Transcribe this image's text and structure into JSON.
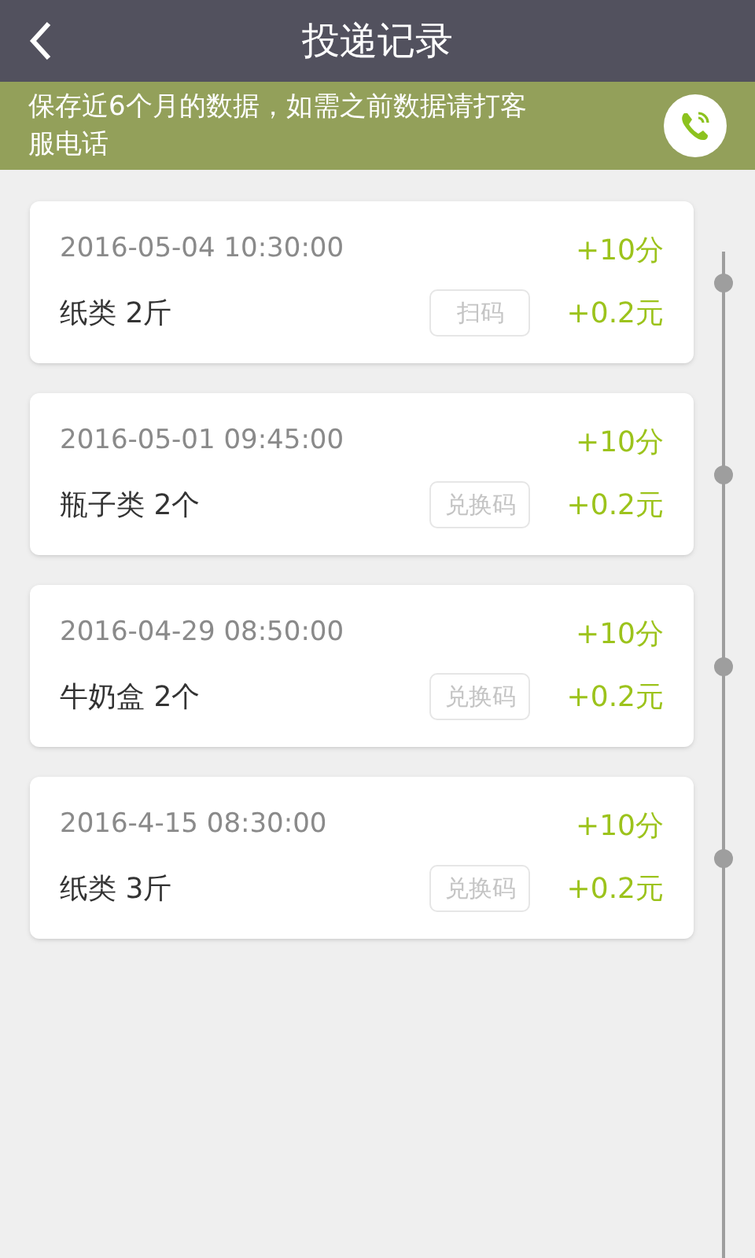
{
  "header": {
    "title": "投递记录"
  },
  "notice": {
    "text": "保存近6个月的数据，如需之前数据请打客服电话"
  },
  "records": [
    {
      "time": "2016-05-04 10:30:00",
      "item": "纸类 2斤",
      "code_button": "扫码",
      "points": "+10分",
      "money": "+0.2元"
    },
    {
      "time": "2016-05-01 09:45:00",
      "item": "瓶子类 2个",
      "code_button": "兑换码",
      "points": "+10分",
      "money": "+0.2元"
    },
    {
      "time": "2016-04-29 08:50:00",
      "item": "牛奶盒 2个",
      "code_button": "兑换码",
      "points": "+10分",
      "money": "+0.2元"
    },
    {
      "time": "2016-4-15 08:30:00",
      "item": "纸类 3斤",
      "code_button": "兑换码",
      "points": "+10分",
      "money": "+0.2元"
    }
  ]
}
